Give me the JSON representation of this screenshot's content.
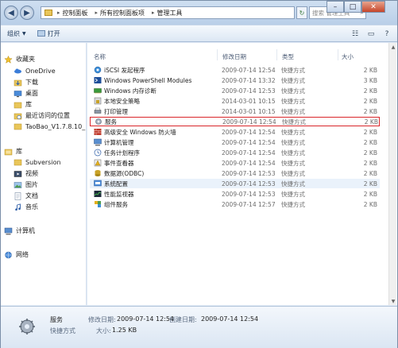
{
  "titlebar": {
    "breadcrumb": [
      "控制面板",
      "所有控制面板项",
      "管理工具"
    ],
    "search_placeholder": "搜索 管理工具"
  },
  "toolbar": {
    "organize_label": "组织",
    "open_label": "打开"
  },
  "sidebar": {
    "favorites": "收藏夹",
    "favorites_items": [
      "OneDrive",
      "下载",
      "桌面",
      "库",
      "最近访问的位置",
      "TaoBao_V1.7.8.10_"
    ],
    "libraries": "库",
    "libraries_items": [
      "Subversion",
      "视频",
      "图片",
      "文档",
      "音乐"
    ],
    "computer": "计算机",
    "network": "网络"
  },
  "columns": {
    "name": "名称",
    "date": "修改日期",
    "type": "类型",
    "size": "大小"
  },
  "files": [
    {
      "name": "iSCSI 发起程序",
      "date": "2009-07-14 12:54",
      "type": "快捷方式",
      "size": "2 KB"
    },
    {
      "name": "Windows PowerShell Modules",
      "date": "2009-07-14 13:32",
      "type": "快捷方式",
      "size": "3 KB"
    },
    {
      "name": "Windows 内存诊断",
      "date": "2009-07-14 12:53",
      "type": "快捷方式",
      "size": "2 KB"
    },
    {
      "name": "本地安全策略",
      "date": "2014-03-01 10:15",
      "type": "快捷方式",
      "size": "2 KB"
    },
    {
      "name": "打印管理",
      "date": "2014-03-01 10:15",
      "type": "快捷方式",
      "size": "2 KB"
    },
    {
      "name": "服务",
      "date": "2009-07-14 12:54",
      "type": "快捷方式",
      "size": "2 KB"
    },
    {
      "name": "高级安全 Windows 防火墙",
      "date": "2009-07-14 12:54",
      "type": "快捷方式",
      "size": "2 KB"
    },
    {
      "name": "计算机管理",
      "date": "2009-07-14 12:54",
      "type": "快捷方式",
      "size": "2 KB"
    },
    {
      "name": "任务计划程序",
      "date": "2009-07-14 12:54",
      "type": "快捷方式",
      "size": "2 KB"
    },
    {
      "name": "事件查看器",
      "date": "2009-07-14 12:54",
      "type": "快捷方式",
      "size": "2 KB"
    },
    {
      "name": "数据源(ODBC)",
      "date": "2009-07-14 12:53",
      "type": "快捷方式",
      "size": "2 KB"
    },
    {
      "name": "系统配置",
      "date": "2009-07-14 12:53",
      "type": "快捷方式",
      "size": "2 KB"
    },
    {
      "name": "性能监视器",
      "date": "2009-07-14 12:53",
      "type": "快捷方式",
      "size": "2 KB"
    },
    {
      "name": "组件服务",
      "date": "2009-07-14 12:57",
      "type": "快捷方式",
      "size": "2 KB"
    }
  ],
  "details": {
    "name": "服务",
    "type": "快捷方式",
    "modified_label": "修改日期:",
    "modified": "2009-07-14 12:54",
    "created_label": "创建日期:",
    "created": "2009-07-14 12:54",
    "size_label": "大小:",
    "size": "1.25 KB"
  },
  "colors": {
    "selection_outline": "#d9262a",
    "chrome": "#dfe9f5"
  }
}
